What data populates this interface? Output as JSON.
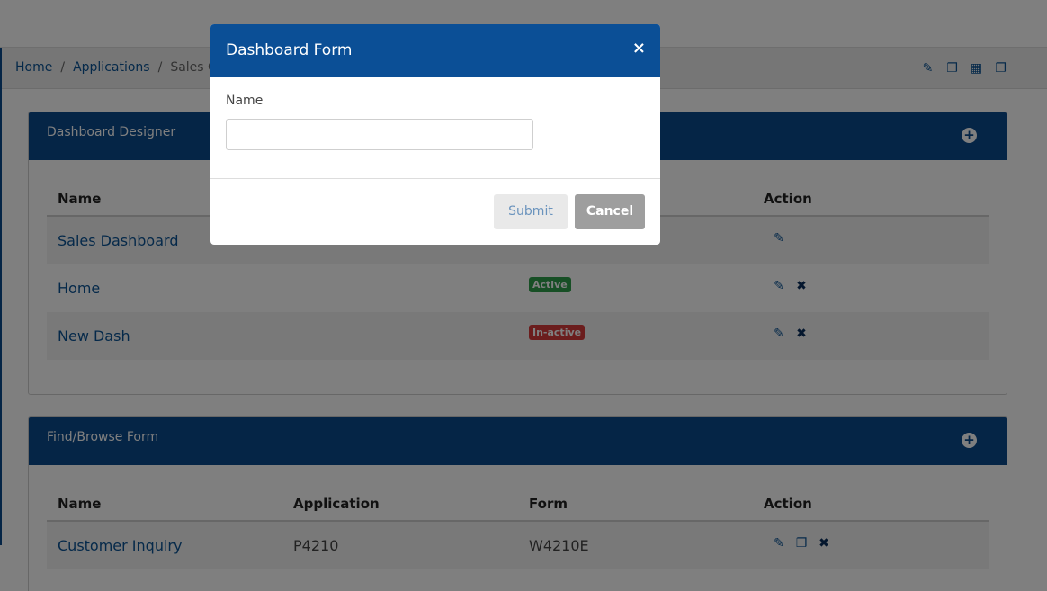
{
  "breadcrumb": {
    "items": [
      "Home",
      "Applications"
    ],
    "current": "Sales C",
    "separator": "/"
  },
  "toolbar_icons": [
    "edit-icon",
    "copy-form-icon",
    "qr-code-icon",
    "duplicate-icon"
  ],
  "dashboard_designer": {
    "title": "Dashboard Designer",
    "add_icon": "+",
    "columns": {
      "name": "Name",
      "action": "Action"
    },
    "rows": [
      {
        "name": "Sales Dashboard",
        "status": "",
        "actions": [
          "edit"
        ]
      },
      {
        "name": "Home",
        "status": "Active",
        "actions": [
          "edit",
          "delete"
        ]
      },
      {
        "name": "New Dash",
        "status": "In-active",
        "actions": [
          "edit",
          "delete"
        ]
      }
    ]
  },
  "find_browse_form": {
    "title": "Find/Browse Form",
    "add_icon": "+",
    "columns": {
      "name": "Name",
      "application": "Application",
      "form": "Form",
      "action": "Action"
    },
    "rows": [
      {
        "name": "Customer Inquiry",
        "application": "P4210",
        "form": "W4210E",
        "actions": [
          "edit",
          "copy",
          "delete"
        ]
      }
    ]
  },
  "modal": {
    "title": "Dashboard Form",
    "close_glyph": "×",
    "name_label": "Name",
    "name_value": "",
    "submit_label": "Submit",
    "cancel_label": "Cancel"
  },
  "glyphs": {
    "edit": "✎",
    "copy": "❐",
    "delete": "✖",
    "qr": "▦"
  },
  "colors": {
    "primary": "#0b4a8c",
    "active": "#2e9e4a",
    "inactive": "#d63b3b"
  }
}
